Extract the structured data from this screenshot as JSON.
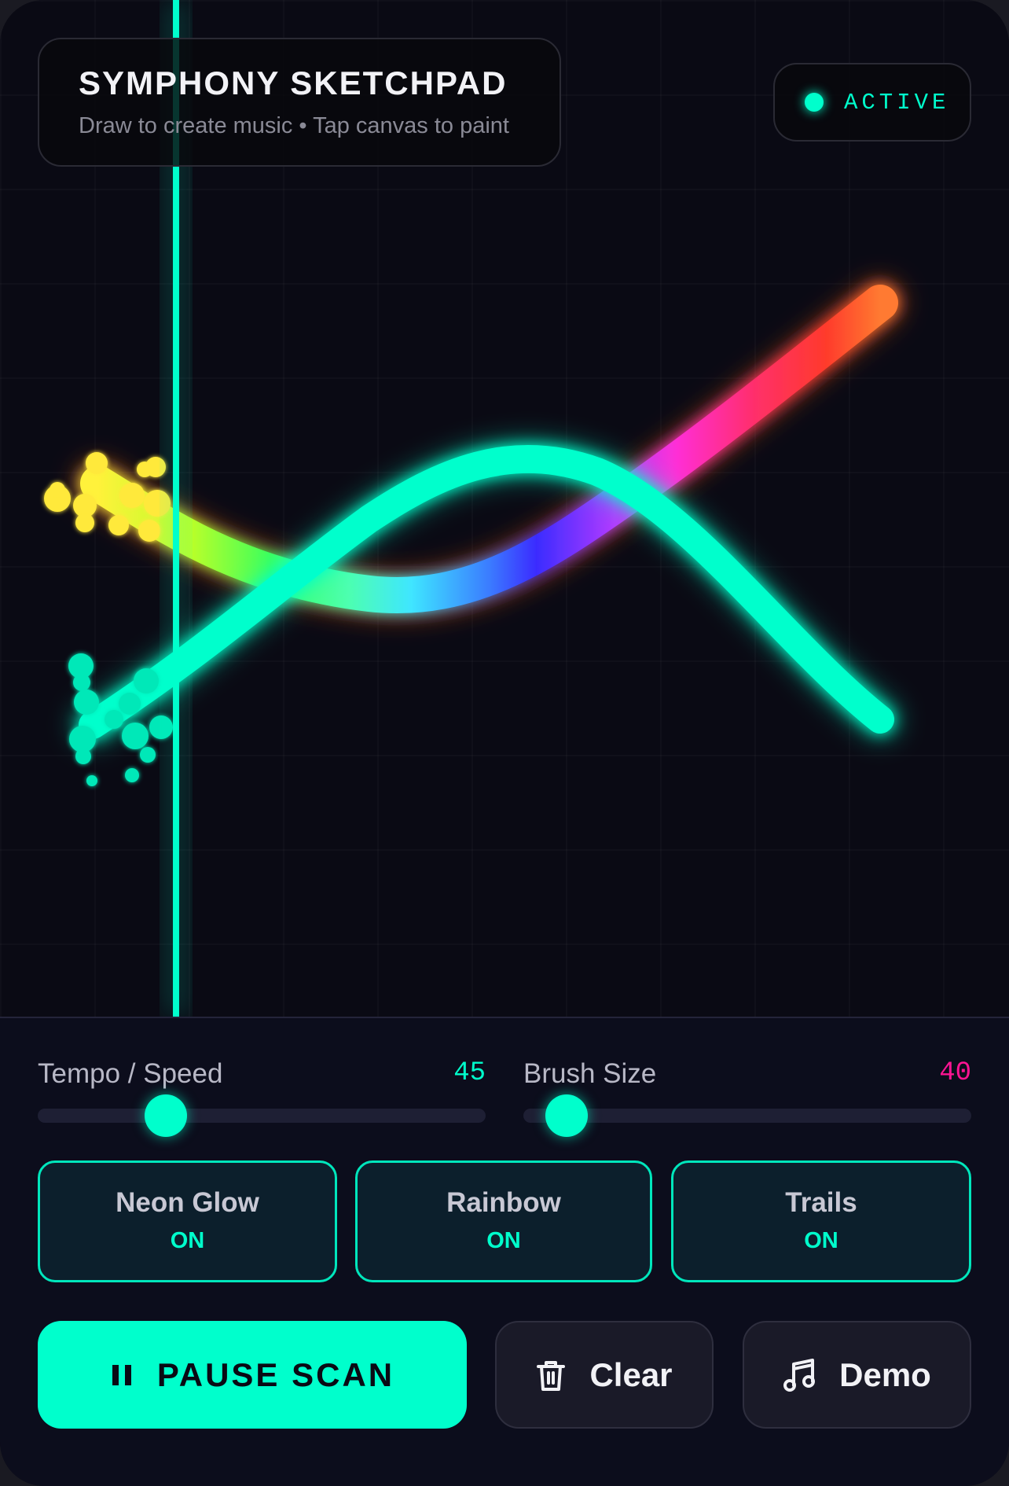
{
  "header": {
    "title": "SYMPHONY SKETCHPAD",
    "subtitle": "Draw to create music • Tap canvas to paint"
  },
  "status": {
    "label": "ACTIVE",
    "color": "#00ffcc"
  },
  "controls": {
    "tempo": {
      "label": "Tempo / Speed",
      "value": "45",
      "fraction": 0.27,
      "value_color": "#00ffcc"
    },
    "brush": {
      "label": "Brush Size",
      "value": "40",
      "fraction": 0.08,
      "value_color": "#ff1493"
    }
  },
  "toggles": [
    {
      "label": "Neon Glow",
      "state": "ON"
    },
    {
      "label": "Rainbow",
      "state": "ON"
    },
    {
      "label": "Trails",
      "state": "ON"
    }
  ],
  "actions": {
    "pause": {
      "label": "PAUSE SCAN",
      "icon": "pause-icon"
    },
    "clear": {
      "label": "Clear",
      "icon": "trash-icon"
    },
    "demo": {
      "label": "Demo",
      "icon": "music-note-icon"
    }
  },
  "theme": {
    "accent": "#00ffcc",
    "background": "#0a0a14",
    "panel": "#0c0d1c"
  }
}
